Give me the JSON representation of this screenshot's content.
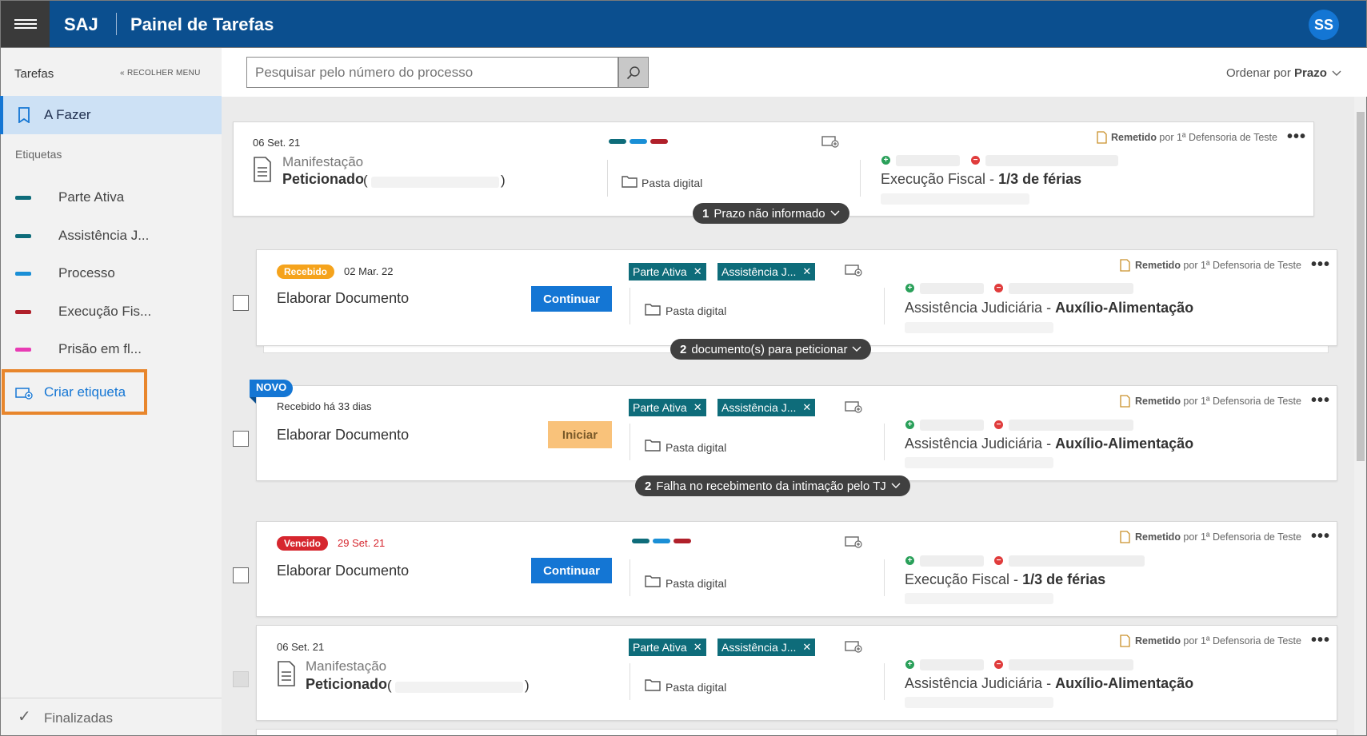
{
  "header": {
    "logo": "SAJ",
    "title": "Painel de Tarefas",
    "avatar": "SS"
  },
  "sidebar": {
    "tarefas": "Tarefas",
    "recolher": "« RECOLHER MENU",
    "afazer": "A Fazer",
    "etiquetas": "Etiquetas",
    "tags": [
      {
        "label": "Parte Ativa",
        "color": "#0e6c7a"
      },
      {
        "label": "Assistência J...",
        "color": "#0e6c7a"
      },
      {
        "label": "Processo",
        "color": "#1a8fd6"
      },
      {
        "label": "Execução Fis...",
        "color": "#b0202a"
      },
      {
        "label": "Prisão em fl...",
        "color": "#e83cb4"
      }
    ],
    "criar": "Criar etiqueta",
    "finalizadas": "Finalizadas"
  },
  "search": {
    "placeholder": "Pesquisar pelo número do processo"
  },
  "ordenar": {
    "prefix": "Ordenar por ",
    "value": "Prazo"
  },
  "common": {
    "pasta": "Pasta digital",
    "remetido": "Remetido",
    "remetido_por": " por 1ª Defensoria de Teste",
    "dots": "•••",
    "paren_open": "(",
    "paren_close": ")"
  },
  "cards": [
    {
      "date": "06 Set. 21",
      "sub": "Manifestação",
      "main": "Peticionado",
      "summary_prefix": "Execução Fiscal - ",
      "summary_bold": "1/3 de férias",
      "pill_count": "1",
      "pill_text": " Prazo não informado"
    },
    {
      "badge": "Recebido",
      "badge_color": "#f5a31c",
      "date": "02 Mar. 22",
      "main": "Elaborar Documento",
      "button": "Continuar",
      "chips": [
        "Parte Ativa",
        "Assistência J..."
      ],
      "summary_prefix": "Assistência Judiciária - ",
      "summary_bold": "Auxílio-Alimentação",
      "pill_count": "2",
      "pill_text": " documento(s) para peticionar"
    },
    {
      "novo": "NOVO",
      "date": "Recebido há 33 dias",
      "main": "Elaborar Documento",
      "button": "Iniciar",
      "chips": [
        "Parte Ativa",
        "Assistência J..."
      ],
      "summary_prefix": "Assistência Judiciária - ",
      "summary_bold": "Auxílio-Alimentação",
      "pill_count": "2",
      "pill_text": " Falha no recebimento da intimação pelo TJ"
    },
    {
      "badge": "Vencido",
      "badge_color": "#d6262e",
      "date": "29 Set. 21",
      "main": "Elaborar Documento",
      "button": "Continuar",
      "summary_prefix": "Execução Fiscal - ",
      "summary_bold": "1/3 de férias"
    },
    {
      "date": "06 Set. 21",
      "sub": "Manifestação",
      "main": "Peticionado",
      "chips": [
        "Parte Ativa",
        "Assistência J..."
      ],
      "summary_prefix": "Assistência Judiciária - ",
      "summary_bold": "Auxílio-Alimentação"
    }
  ]
}
